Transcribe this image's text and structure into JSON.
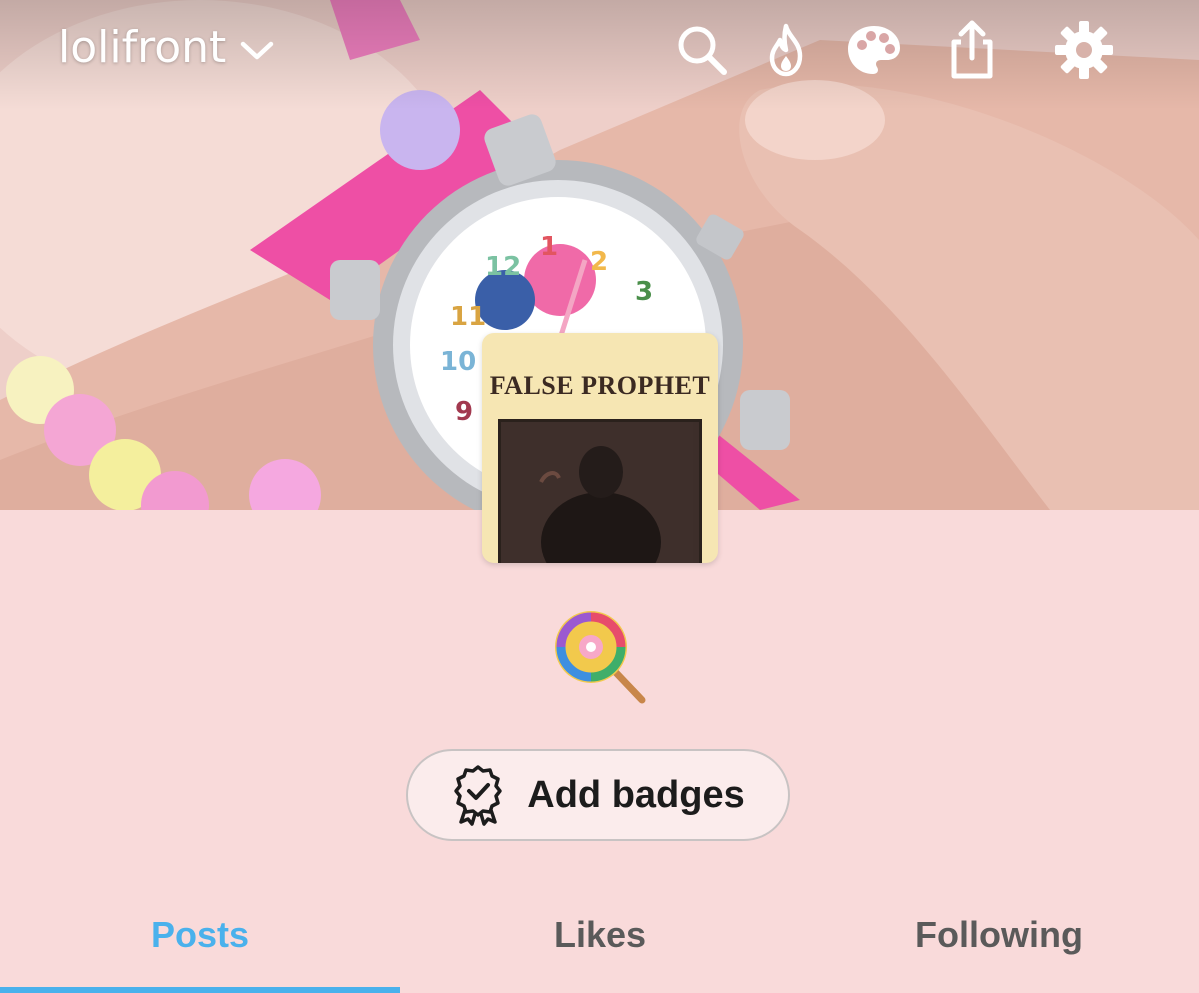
{
  "header": {
    "blog_name": "lolifront",
    "icons": [
      "search-icon",
      "activity-flame-icon",
      "palette-icon",
      "share-icon",
      "settings-gear-icon"
    ]
  },
  "avatar": {
    "caption": "FALSE PROPHET"
  },
  "description": {
    "emoji": "lollipop"
  },
  "badges": {
    "button_label": "Add badges"
  },
  "tabs": [
    {
      "label": "Posts",
      "active": true
    },
    {
      "label": "Likes",
      "active": false
    },
    {
      "label": "Following",
      "active": false
    }
  ],
  "colors": {
    "background": "#f9dada",
    "accent": "#4ab1ec",
    "tab_inactive": "#5a5a5a"
  }
}
